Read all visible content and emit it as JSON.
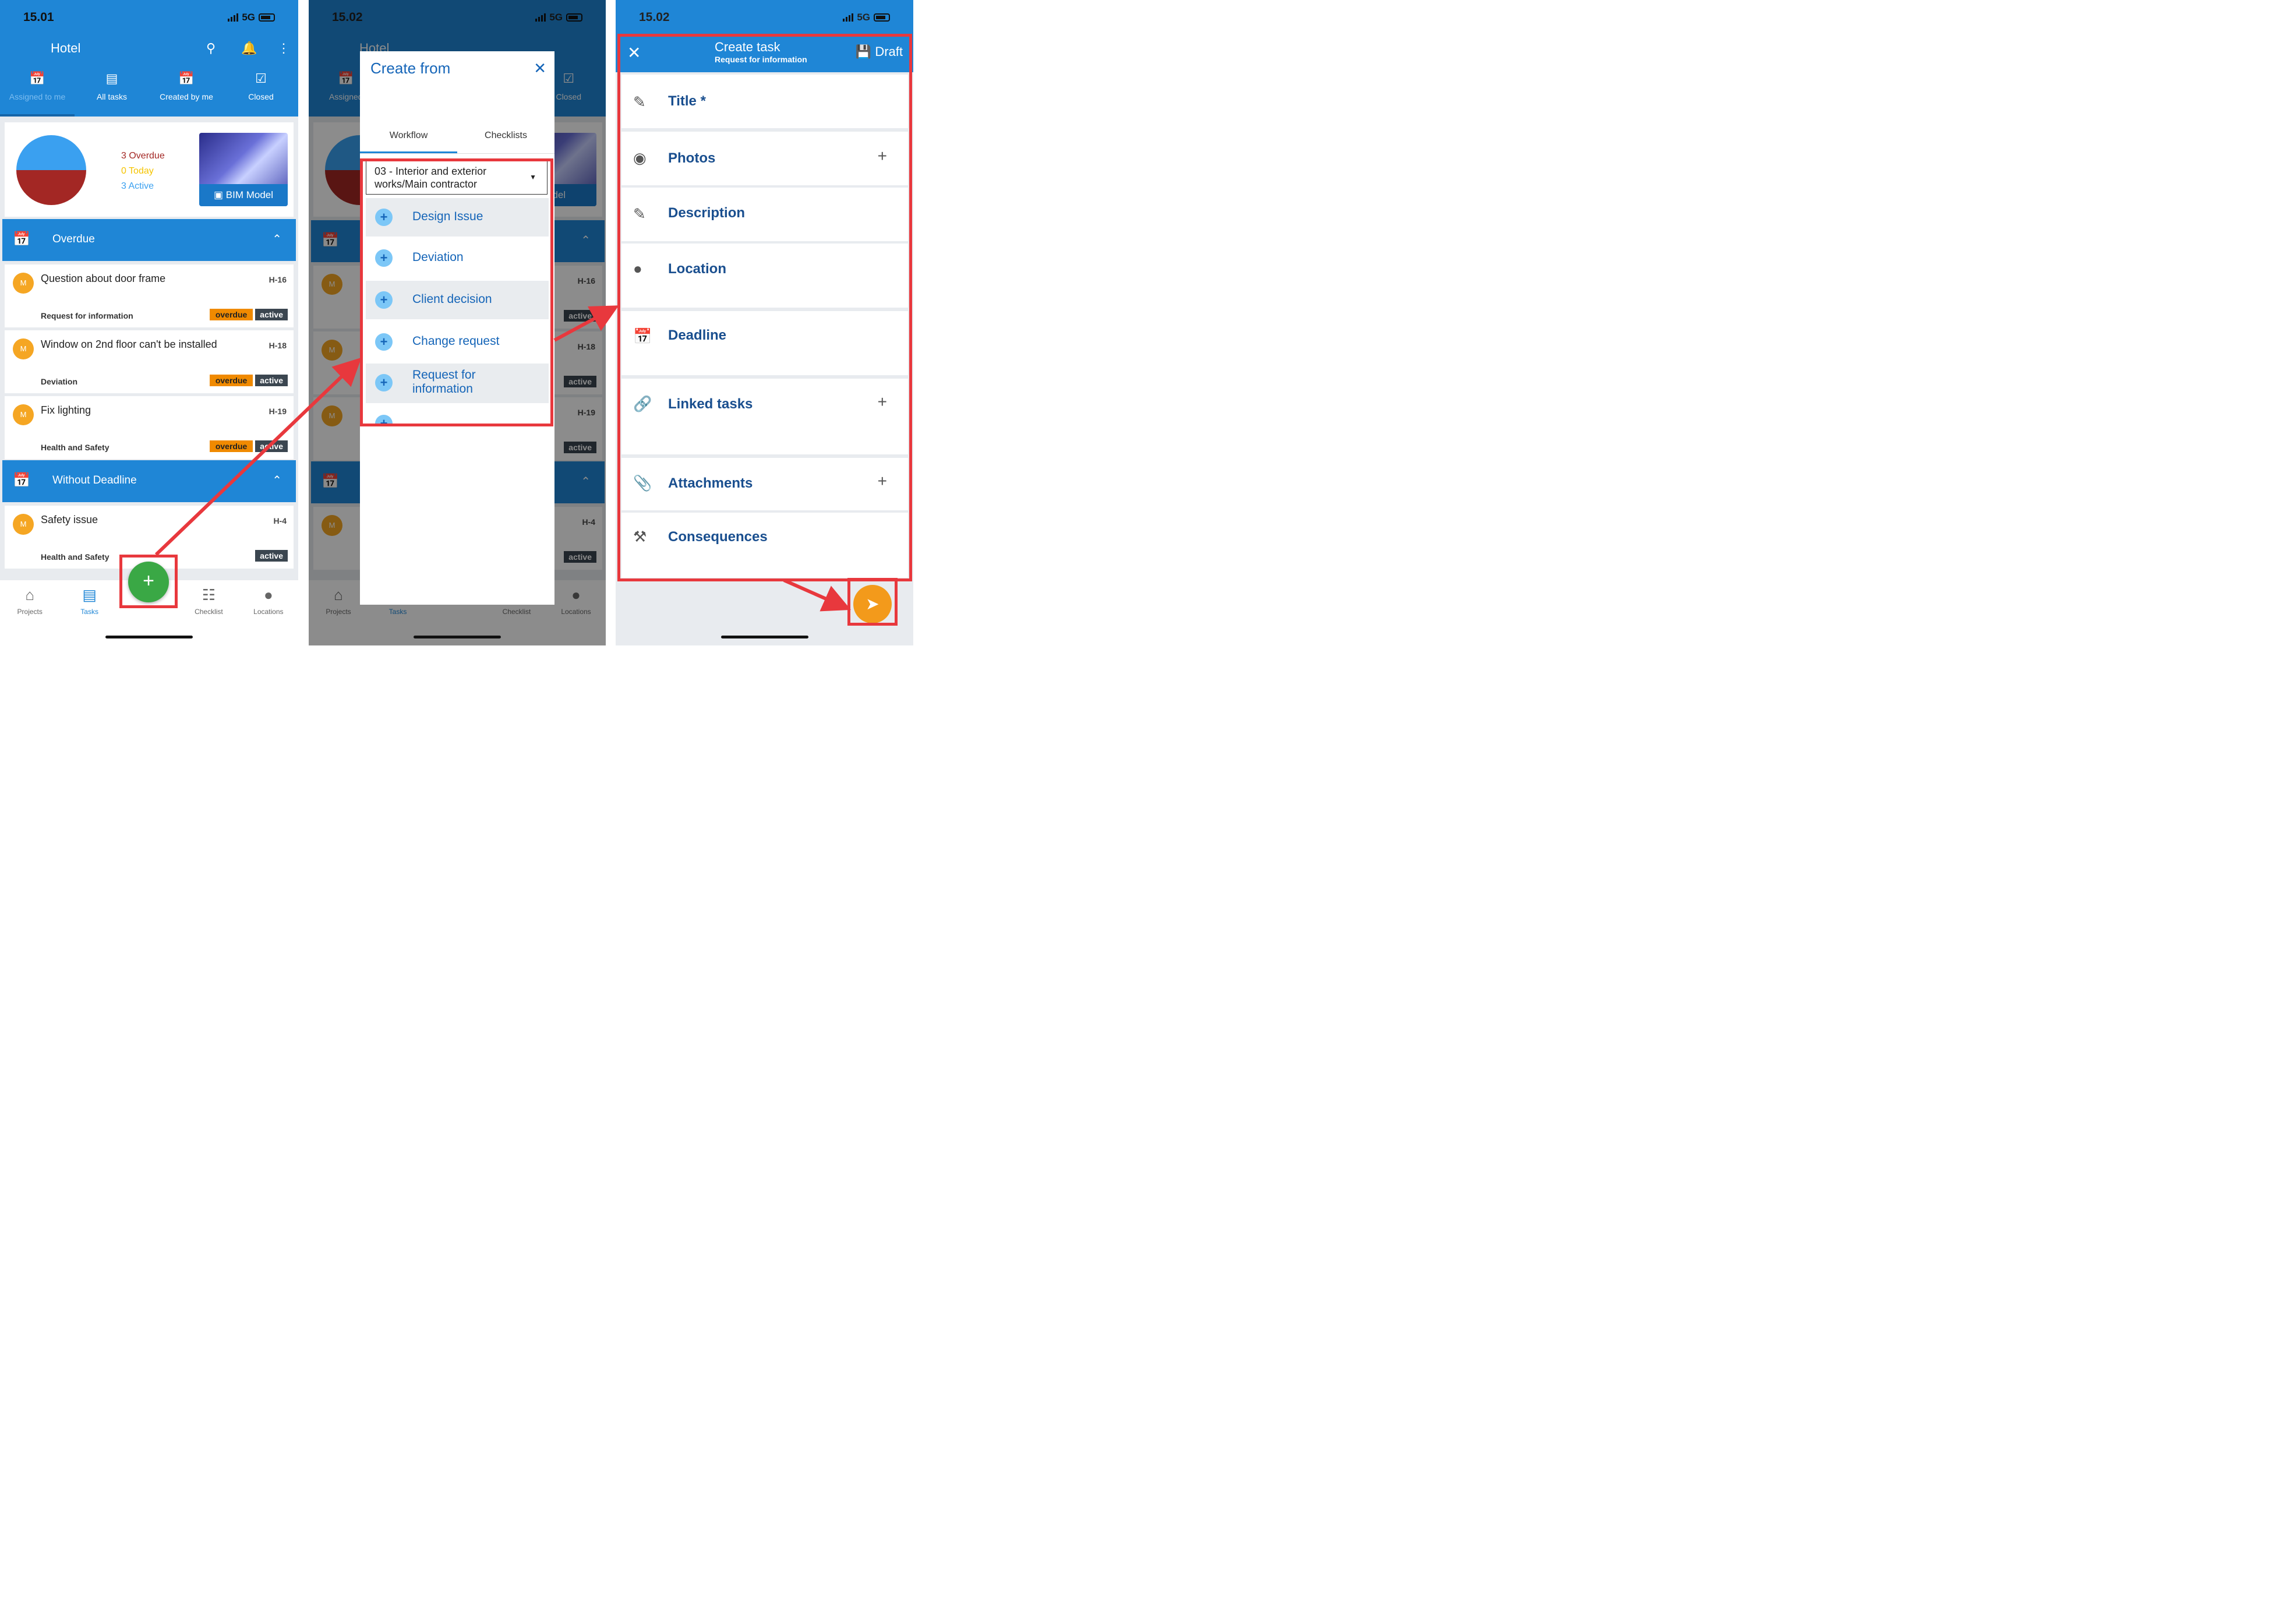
{
  "screen1": {
    "time": "15.01",
    "network": "5G",
    "title": "Hotel",
    "tabs": [
      {
        "label": "Assigned to me",
        "icon": "calendar-alert-icon"
      },
      {
        "label": "All tasks",
        "icon": "list-icon"
      },
      {
        "label": "Created by me",
        "icon": "calendar-plus-icon"
      },
      {
        "label": "Closed",
        "icon": "checkbox-icon"
      }
    ],
    "summary": {
      "overdue": "3 Overdue",
      "today": "0 Today",
      "active": "3 Active",
      "bim_label": "BIM Model"
    },
    "sections": {
      "overdue": "Overdue",
      "without_deadline": "Without Deadline"
    },
    "tasks": [
      {
        "avatar": "M",
        "title": "Question about door frame",
        "code": "H-16",
        "category": "Request for information",
        "overdue": "overdue",
        "status": "active"
      },
      {
        "avatar": "M",
        "title": "Window on 2nd floor can't be installed",
        "code": "H-18",
        "category": "Deviation",
        "overdue": "overdue",
        "status": "active"
      },
      {
        "avatar": "M",
        "title": "Fix lighting",
        "code": "H-19",
        "category": "Health and Safety",
        "overdue": "overdue",
        "status": "active"
      },
      {
        "avatar": "M",
        "title": "Safety issue",
        "code": "H-4",
        "category": "Health and Safety",
        "overdue": "",
        "status": "active"
      }
    ],
    "nav": [
      {
        "label": "Projects",
        "icon": "home-icon"
      },
      {
        "label": "Tasks",
        "icon": "task-list-icon"
      },
      {
        "label": "Checklist",
        "icon": "checklist-icon"
      },
      {
        "label": "Locations",
        "icon": "location-pin-icon"
      }
    ],
    "fab": "+"
  },
  "screen2": {
    "time": "15.02",
    "network": "5G",
    "dialog_title": "Create from",
    "tabs": [
      "Workflow",
      "Checklists"
    ],
    "select_value": "03 - Interior and exterior works/Main contractor",
    "workflows": [
      "Design Issue",
      "Deviation",
      "Client decision",
      "Change request",
      "Request for information"
    ],
    "bg_title": "Hotel",
    "bg_tab1": "Assigned",
    "bg_tab4": "Closed",
    "bg_bim": "Model",
    "bg_codes": [
      "H-16",
      "H-18",
      "H-19",
      "H-4"
    ],
    "bg_status": "active",
    "nav": [
      "Projects",
      "Tasks",
      "Checklist",
      "Locations"
    ]
  },
  "screen3": {
    "time": "15.02",
    "network": "5G",
    "title": "Create task",
    "subtitle": "Request for information",
    "draft": "Draft",
    "fields": [
      {
        "label": "Title *",
        "icon": "pencil-icon",
        "plus": false
      },
      {
        "label": "Photos",
        "icon": "camera-icon",
        "plus": true
      },
      {
        "label": "Description",
        "icon": "pencil-icon",
        "plus": false
      },
      {
        "label": "Location",
        "icon": "location-pin-icon",
        "plus": false
      },
      {
        "label": "Deadline",
        "icon": "calendar-icon",
        "plus": false
      },
      {
        "label": "Linked tasks",
        "icon": "link-icon",
        "plus": true
      },
      {
        "label": "Attachments",
        "icon": "paperclip-icon",
        "plus": true
      },
      {
        "label": "Consequences",
        "icon": "hammer-icon",
        "plus": false
      }
    ]
  },
  "colors": {
    "primary": "#1f86d6",
    "highlight": "#e8383d",
    "fab_green": "#3aa845",
    "send_orange": "#f39a1b",
    "overdue": "#a32724",
    "today": "#f5c400",
    "active": "#3aa0f0"
  }
}
